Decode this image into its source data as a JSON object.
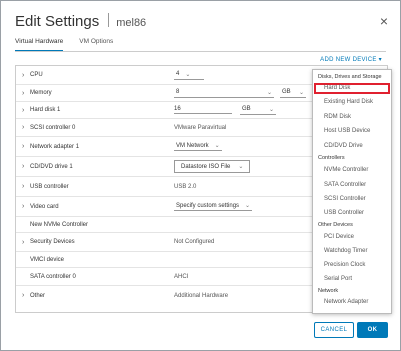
{
  "dialog": {
    "title": "Edit Settings",
    "vm_name": "mel86",
    "close": "×"
  },
  "tabs": [
    "Virtual Hardware",
    "VM Options"
  ],
  "add_new_device": "ADD NEW DEVICE ▾",
  "rows": {
    "cpu": {
      "label": "CPU",
      "value": "4"
    },
    "memory": {
      "label": "Memory",
      "value": "8",
      "unit": "GB"
    },
    "hard_disk": {
      "label": "Hard disk 1",
      "value": "16",
      "unit": "GB"
    },
    "scsi": {
      "label": "SCSI controller 0",
      "value": "VMware Paravirtual"
    },
    "network": {
      "label": "Network adapter 1",
      "value": "VM Network"
    },
    "cddvd": {
      "label": "CD/DVD drive 1",
      "value": "Datastore ISO File"
    },
    "usb": {
      "label": "USB controller",
      "value": "USB 2.0"
    },
    "video": {
      "label": "Video card",
      "value": "Specify custom settings"
    },
    "nvme": {
      "label": "New NVMe Controller",
      "value": ""
    },
    "security": {
      "label": "Security Devices",
      "value": "Not Configured"
    },
    "vmci": {
      "label": "VMCI device",
      "value": ""
    },
    "sata": {
      "label": "SATA controller 0",
      "value": "AHCI"
    },
    "other": {
      "label": "Other",
      "value": "Additional Hardware"
    }
  },
  "menu": {
    "h_disks": "Disks, Drives and Storage",
    "hard_disk": "Hard Disk",
    "existing_hard_disk": "Existing Hard Disk",
    "rdm_disk": "RDM Disk",
    "host_usb": "Host USB Device",
    "cddvd": "CD/DVD Drive",
    "h_controllers": "Controllers",
    "nvme": "NVMe Controller",
    "sata": "SATA Controller",
    "scsi": "SCSI Controller",
    "usb": "USB Controller",
    "h_other": "Other Devices",
    "pci": "PCI Device",
    "watchdog": "Watchdog Timer",
    "precision": "Precision Clock",
    "serial": "Serial Port",
    "h_network": "Network",
    "network_adapter": "Network Adapter"
  },
  "buttons": {
    "cancel": "CANCEL",
    "ok": "OK"
  },
  "caret": "⌄",
  "chevron": "›",
  "colors": {
    "accent": "#0079b8",
    "highlight": "#e0202f"
  }
}
